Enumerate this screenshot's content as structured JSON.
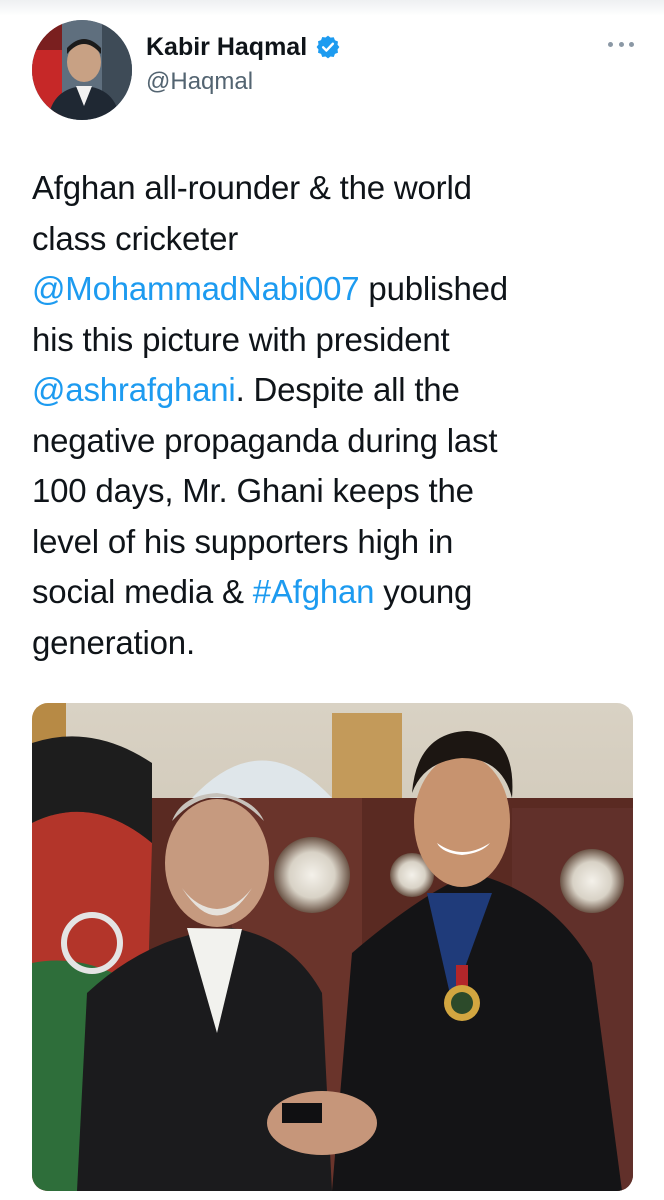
{
  "tweet": {
    "author": {
      "display_name": "Kabir Haqmal",
      "handle": "@Haqmal",
      "verified": true,
      "verified_color": "#1d9bf0"
    },
    "more_icon": "more-horizontal-icon",
    "text_lines": [
      [
        {
          "t": "Afghan all-rounder & the world"
        }
      ],
      [
        {
          "t": "class cricketer"
        }
      ],
      [
        {
          "t": "@MohammadNabi007",
          "link": true
        },
        {
          "t": " published"
        }
      ],
      [
        {
          "t": "his this picture with president"
        }
      ],
      [
        {
          "t": "@ashrafghani",
          "link": true
        },
        {
          "t": ". Despite all the"
        }
      ],
      [
        {
          "t": "negative propaganda during last"
        }
      ],
      [
        {
          "t": "100 days, Mr. Ghani keeps the"
        }
      ],
      [
        {
          "t": "level of his supporters high in"
        }
      ],
      [
        {
          "t": "social media & "
        },
        {
          "t": "#Afghan",
          "link": true
        },
        {
          "t": " young"
        }
      ],
      [
        {
          "t": "generation."
        }
      ]
    ],
    "colors": {
      "text": "#0f1419",
      "link": "#1d9bf0",
      "secondary": "#536471"
    }
  }
}
